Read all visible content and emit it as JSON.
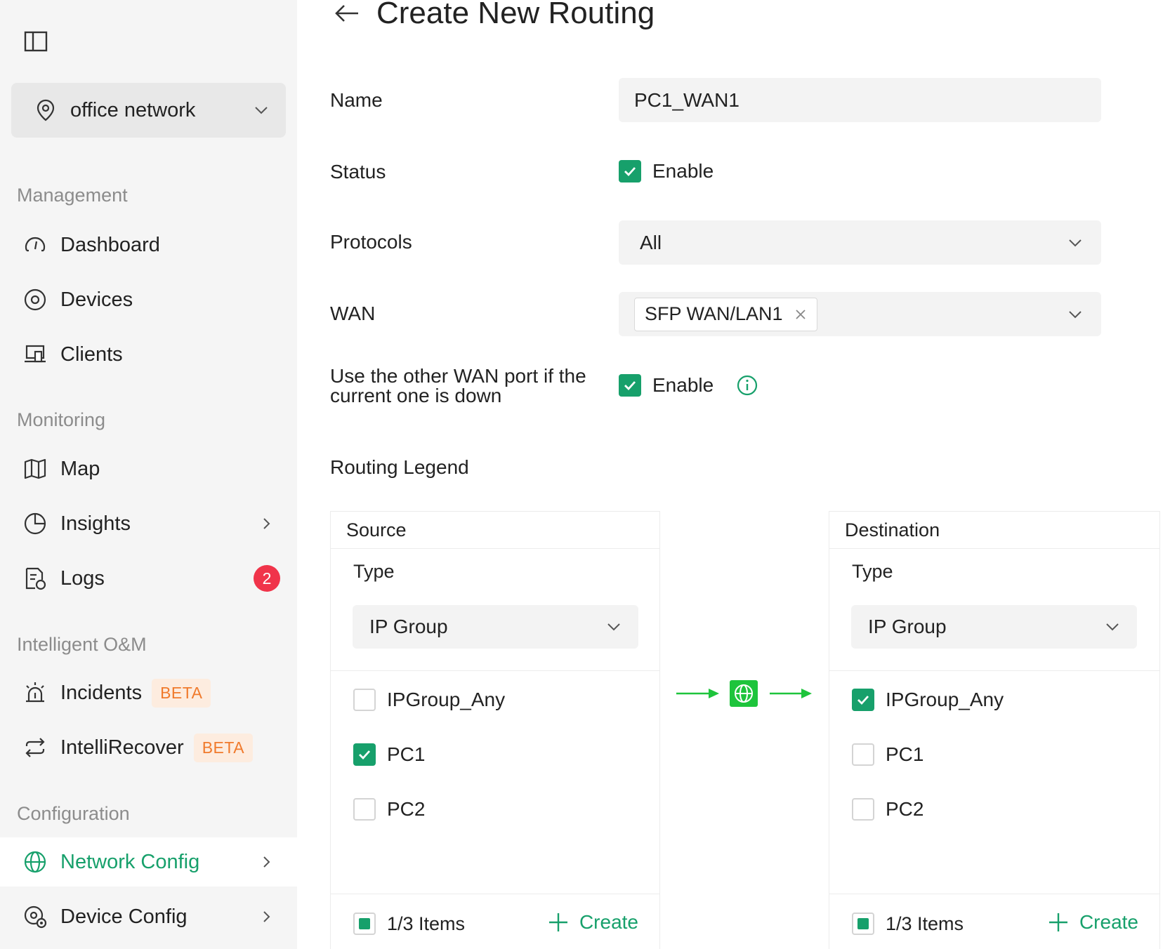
{
  "sidebar": {
    "site": {
      "name": "office network",
      "icon": "location-pin-icon"
    },
    "sections": {
      "management": "Management",
      "monitoring": "Monitoring",
      "intelligent": "Intelligent O&M",
      "configuration": "Configuration"
    },
    "items": {
      "dashboard": "Dashboard",
      "devices": "Devices",
      "clients": "Clients",
      "map": "Map",
      "insights": "Insights",
      "logs": "Logs",
      "logs_badge": "2",
      "incidents": "Incidents",
      "incidents_badge": "BETA",
      "intellirecover": "IntelliRecover",
      "intellirecover_badge": "BETA",
      "network_config": "Network Config",
      "device_config": "Device Config"
    },
    "active_item": "Network Config"
  },
  "header": {
    "title": "Create New Routing"
  },
  "form": {
    "name_label": "Name",
    "name_value": "PC1_WAN1",
    "status_label": "Status",
    "status_option": "Enable",
    "status_checked": true,
    "protocols_label": "Protocols",
    "protocols_value": "All",
    "wan_label": "WAN",
    "wan_tag": "SFP WAN/LAN1",
    "failover_label_line1": "Use the other WAN port if the",
    "failover_label_line2": "current one is down",
    "failover_option": "Enable",
    "failover_checked": true
  },
  "routing_legend": {
    "title": "Routing Legend",
    "source": {
      "title": "Source",
      "type_label": "Type",
      "type_value": "IP Group",
      "options": [
        {
          "label": "IPGroup_Any",
          "checked": false
        },
        {
          "label": "PC1",
          "checked": true
        },
        {
          "label": "PC2",
          "checked": false
        }
      ],
      "count": "1/3 Items",
      "create_label": "Create"
    },
    "destination": {
      "title": "Destination",
      "type_label": "Type",
      "type_value": "IP Group",
      "options": [
        {
          "label": "IPGroup_Any",
          "checked": true
        },
        {
          "label": "PC1",
          "checked": false
        },
        {
          "label": "PC2",
          "checked": false
        }
      ],
      "count": "1/3 Items",
      "create_label": "Create"
    }
  },
  "colors": {
    "accent": "#17a06b",
    "flow_green": "#1ec43c",
    "badge_red": "#f0344a",
    "beta_orange": "#f07a2c"
  }
}
